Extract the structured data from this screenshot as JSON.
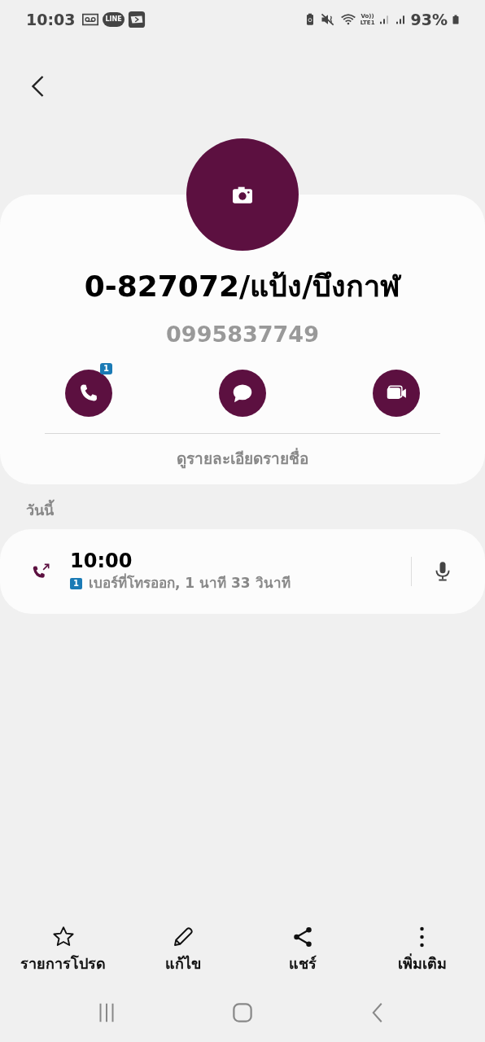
{
  "status_bar": {
    "time": "10:03",
    "app_icon_label": "LINE",
    "network_label": [
      "Vo))",
      "LTE1"
    ],
    "battery": "93%"
  },
  "contact": {
    "name": "0-827072/แป้ง/บึงกาฬ",
    "number": "0995837749",
    "actions": [
      {
        "kind": "call",
        "badge": "1"
      },
      {
        "kind": "message"
      },
      {
        "kind": "video"
      }
    ],
    "details_link": "ดูรายละเอียดรายชื่อ"
  },
  "history": {
    "heading": "วันนี้",
    "calls": [
      {
        "kind": "outgoing",
        "time": "10:00",
        "sim": "1",
        "description": "เบอร์ที่โทรออก, 1 นาที 33 วินาที",
        "recorded": true
      }
    ]
  },
  "bottom_actions": [
    {
      "kind": "favorite",
      "label": "รายการโปรด"
    },
    {
      "kind": "edit",
      "label": "แก้ไข"
    },
    {
      "kind": "share",
      "label": "แชร์"
    },
    {
      "kind": "more",
      "label": "เพิ่มเติม"
    }
  ]
}
